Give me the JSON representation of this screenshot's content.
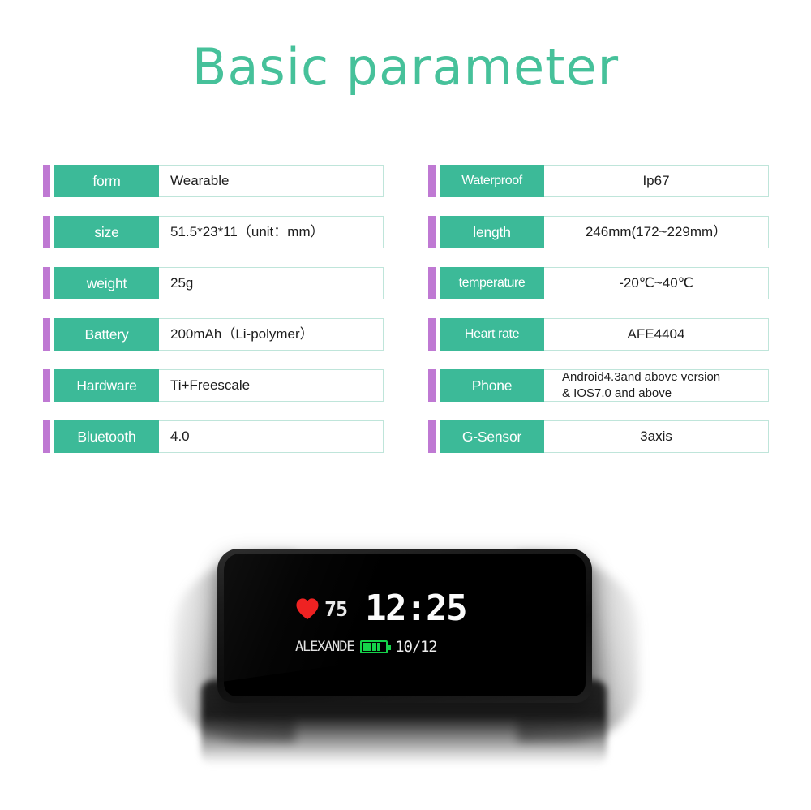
{
  "title": "Basic parameter",
  "colors": {
    "title_green": "#46c19a",
    "label_green": "#3cba98",
    "accent_purple": "#bf79d3",
    "cell_border": "#bfe5da",
    "heart_red": "#ee2222",
    "battery_green": "#15d34a"
  },
  "spec_table": {
    "left_column": [
      {
        "label": "form",
        "value": "Wearable"
      },
      {
        "label": "size",
        "value": "51.5*23*11（unit：mm）"
      },
      {
        "label": "weight",
        "value": "25g"
      },
      {
        "label": "Battery",
        "value": "200mAh（Li-polymer）"
      },
      {
        "label": "Hardware",
        "value": "Ti+Freescale"
      },
      {
        "label": "Bluetooth",
        "value": "4.0"
      }
    ],
    "right_column": [
      {
        "label": "Waterproof",
        "value": "Ip67"
      },
      {
        "label": "length",
        "value": "246mm(172~229mm）"
      },
      {
        "label": "temperature",
        "value": "-20℃~40℃"
      },
      {
        "label": "Heart rate",
        "value": "AFE4404"
      },
      {
        "label": "Phone",
        "value": "Android4.3and above version\n& IOS7.0 and above"
      },
      {
        "label": "G-Sensor",
        "value": "3axis"
      }
    ]
  },
  "watch_display": {
    "heart_rate": "75",
    "time": "12:25",
    "owner_name": "ALEXANDE",
    "date": "10/12",
    "battery_level_percent": 74
  }
}
